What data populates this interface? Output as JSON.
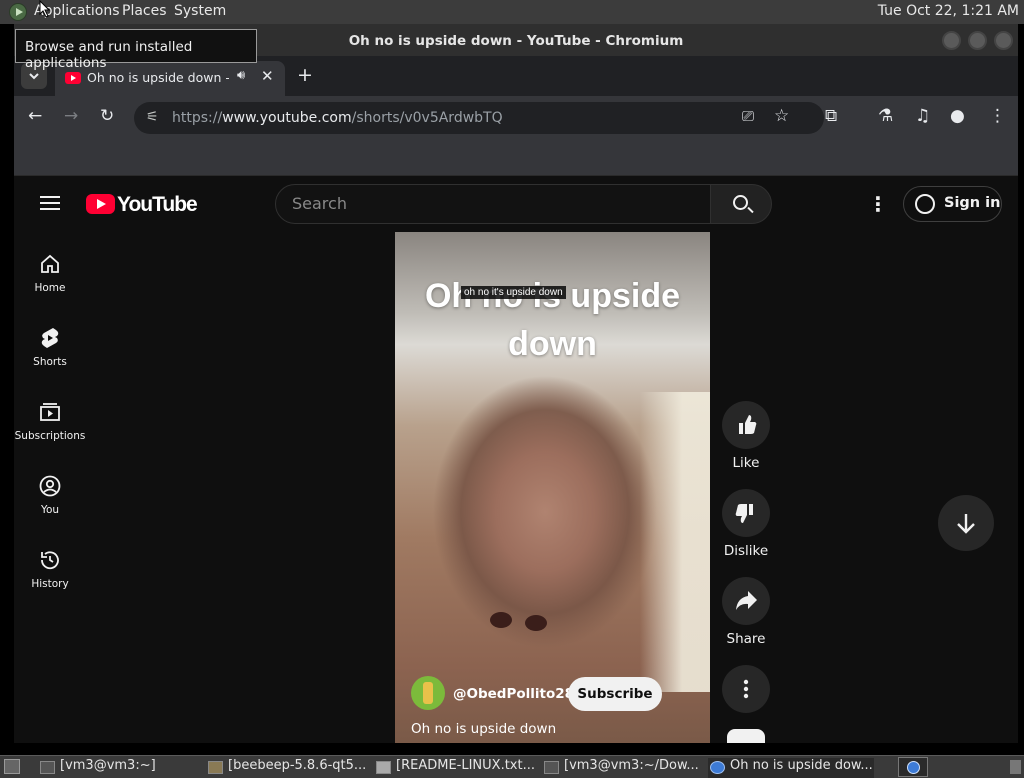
{
  "desktop": {
    "menus": [
      "Applications",
      "Places",
      "System"
    ],
    "clock": "Tue Oct 22,  1:21 AM",
    "tooltip": "Browse and run installed applications"
  },
  "window": {
    "title": "Oh no is upside down - YouTube - Chromium"
  },
  "browser": {
    "tab_title": "Oh no is upside down - YouTube",
    "url_scheme": "https://",
    "url_host": "www.youtube.com",
    "url_path": "/shorts/v0v5ArdwbTQ"
  },
  "youtube": {
    "logo_text": "YouTube",
    "search_placeholder": "Search",
    "sign_in": "Sign in",
    "sidebar": [
      {
        "label": "Home",
        "icon": "home-icon"
      },
      {
        "label": "Shorts",
        "icon": "shorts-icon"
      },
      {
        "label": "Subscriptions",
        "icon": "subscriptions-icon"
      },
      {
        "label": "You",
        "icon": "you-icon"
      },
      {
        "label": "History",
        "icon": "history-icon"
      }
    ],
    "short": {
      "overlay_title": "Oh no is upside down",
      "caption": "oh no it's upside down",
      "channel": "@ObedPollito285",
      "subscribe": "Subscribe",
      "description": "Oh no is upside down"
    },
    "actions": {
      "like": "Like",
      "dislike": "Dislike",
      "share": "Share"
    }
  },
  "taskbar": [
    {
      "label": "[vm3@vm3:~]",
      "icon": "terminal-icon"
    },
    {
      "label": "[beebeep-5.8.6-qt5...",
      "icon": "folder-icon"
    },
    {
      "label": "[README-LINUX.txt...",
      "icon": "text-editor-icon"
    },
    {
      "label": "[vm3@vm3:~/Dow...",
      "icon": "terminal-icon"
    },
    {
      "label": "Oh no is upside dow...",
      "icon": "chromium-icon"
    }
  ],
  "colors": {
    "youtube_red": "#ff0033",
    "page_bg": "#0f0f0f",
    "panel_bg": "#3c3c3c"
  }
}
